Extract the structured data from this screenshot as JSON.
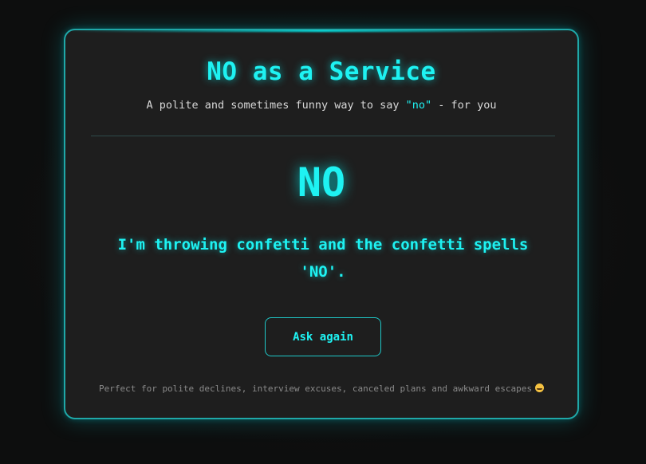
{
  "header": {
    "title": "NO as a Service",
    "subtitle_before": "A polite and sometimes funny way to say ",
    "subtitle_accent": "\"no\"",
    "subtitle_after": " - for you"
  },
  "result": {
    "answer": "NO",
    "reason": "I'm throwing confetti and the confetti spells 'NO'."
  },
  "actions": {
    "ask_again_label": "Ask again"
  },
  "footer": {
    "text": "Perfect for polite declines, interview excuses, canceled plans and awkward escapes",
    "emoji_icon": "grinning-face-icon"
  },
  "colors": {
    "accent": "#1ef2f2",
    "background": "#0d0e0e",
    "card": "#1e1e1e",
    "border": "#1fa8a8"
  }
}
